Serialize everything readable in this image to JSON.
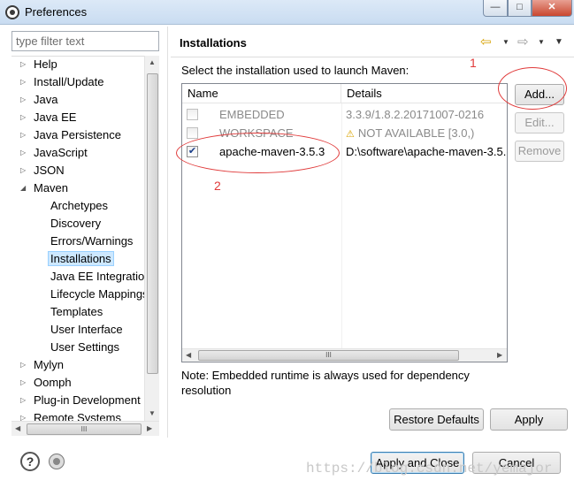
{
  "window": {
    "title": "Preferences",
    "controls": {
      "minimize": "—",
      "maximize": "□",
      "close": "✕"
    }
  },
  "sidebar": {
    "filter_placeholder": "type filter text",
    "items": [
      {
        "label": "Help",
        "twisty": "▷"
      },
      {
        "label": "Install/Update",
        "twisty": "▷"
      },
      {
        "label": "Java",
        "twisty": "▷"
      },
      {
        "label": "Java EE",
        "twisty": "▷"
      },
      {
        "label": "Java Persistence",
        "twisty": "▷"
      },
      {
        "label": "JavaScript",
        "twisty": "▷"
      },
      {
        "label": "JSON",
        "twisty": "▷"
      },
      {
        "label": "Maven",
        "twisty": "◢"
      },
      {
        "label": "Archetypes"
      },
      {
        "label": "Discovery"
      },
      {
        "label": "Errors/Warnings"
      },
      {
        "label": "Installations"
      },
      {
        "label": "Java EE Integration"
      },
      {
        "label": "Lifecycle Mappings"
      },
      {
        "label": "Templates"
      },
      {
        "label": "User Interface"
      },
      {
        "label": "User Settings"
      },
      {
        "label": "Mylyn",
        "twisty": "▷"
      },
      {
        "label": "Oomph",
        "twisty": "▷"
      },
      {
        "label": "Plug-in Development",
        "twisty": "▷"
      },
      {
        "label": "Remote Systems",
        "twisty": "▷"
      }
    ],
    "scroll": {
      "up": "▲",
      "down": "▼",
      "left": "◀",
      "right": "▶",
      "grip": "III"
    }
  },
  "page": {
    "title": "Installations",
    "nav": {
      "back": "⇦",
      "forward": "⇨",
      "menu": "▼"
    },
    "instruction": "Select the installation used to launch Maven:",
    "table": {
      "headers": {
        "name": "Name",
        "details": "Details"
      },
      "rows": [
        {
          "name": "EMBEDDED",
          "details": "3.3.9/1.8.2.20171007-0216",
          "checked": "",
          "disabled": true
        },
        {
          "name": "WORKSPACE",
          "details": "NOT AVAILABLE [3.0,)",
          "warning": "⚠",
          "checked": "",
          "disabled": true
        },
        {
          "name": "apache-maven-3.5.3",
          "details": "D:\\software\\apache-maven-3.5.",
          "checked": "✔",
          "disabled": false
        }
      ],
      "scroll_grip": "III"
    },
    "buttons": {
      "add": "Add...",
      "edit": "Edit...",
      "remove": "Remove"
    },
    "note": "Note: Embedded runtime is always used for dependency resolution",
    "restore_defaults": "Restore Defaults",
    "apply": "Apply"
  },
  "footer": {
    "help": "?",
    "apply_and_close": "Apply and Close",
    "cancel": "Cancel"
  },
  "annotations": {
    "one": "1",
    "two": "2",
    "color": "#e03a3a"
  },
  "watermark": "https://blog.csdn.net/yemajor"
}
